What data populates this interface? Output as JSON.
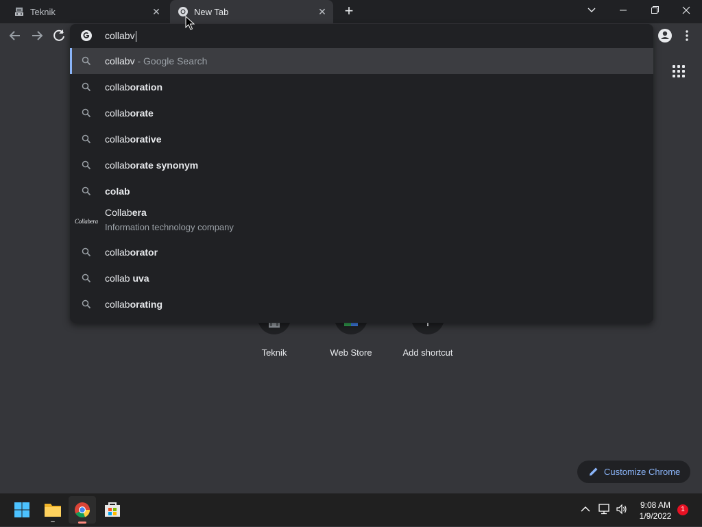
{
  "tabs": [
    {
      "title": "Teknik",
      "active": false
    },
    {
      "title": "New Tab",
      "active": true
    }
  ],
  "omnibox": {
    "input_value": "collabv",
    "suggestions": [
      {
        "typed": "collab",
        "completion": "v",
        "suffix": " - Google Search",
        "icon": "search-icon",
        "selected": true
      },
      {
        "typed": "collab",
        "completion": "oration",
        "icon": "search-icon"
      },
      {
        "typed": "collab",
        "completion": "orate",
        "icon": "search-icon"
      },
      {
        "typed": "collab",
        "completion": "orative",
        "icon": "search-icon"
      },
      {
        "typed": "collab",
        "completion": "orate synonym",
        "icon": "search-icon"
      },
      {
        "typed": "",
        "completion": "colab",
        "icon": "search-icon"
      },
      {
        "typed": "Collab",
        "completion": "era",
        "description": "Information technology company",
        "logo": "Collabera",
        "icon": "collabera-logo"
      },
      {
        "typed": "collab",
        "completion": "orator",
        "icon": "search-icon"
      },
      {
        "typed": "collab ",
        "completion": "uva",
        "icon": "search-icon"
      },
      {
        "typed": "collab",
        "completion": "orating",
        "icon": "search-icon"
      }
    ]
  },
  "shortcuts": [
    {
      "label": "Teknik"
    },
    {
      "label": "Web Store"
    },
    {
      "label": "Add shortcut"
    }
  ],
  "customize_label": "Customize Chrome",
  "taskbar": {
    "time": "9:08 AM",
    "date": "1/9/2022",
    "notification_count": "1"
  },
  "colors": {
    "accent": "#8ab4f8",
    "background": "#35363a",
    "dropdown": "#202124"
  }
}
